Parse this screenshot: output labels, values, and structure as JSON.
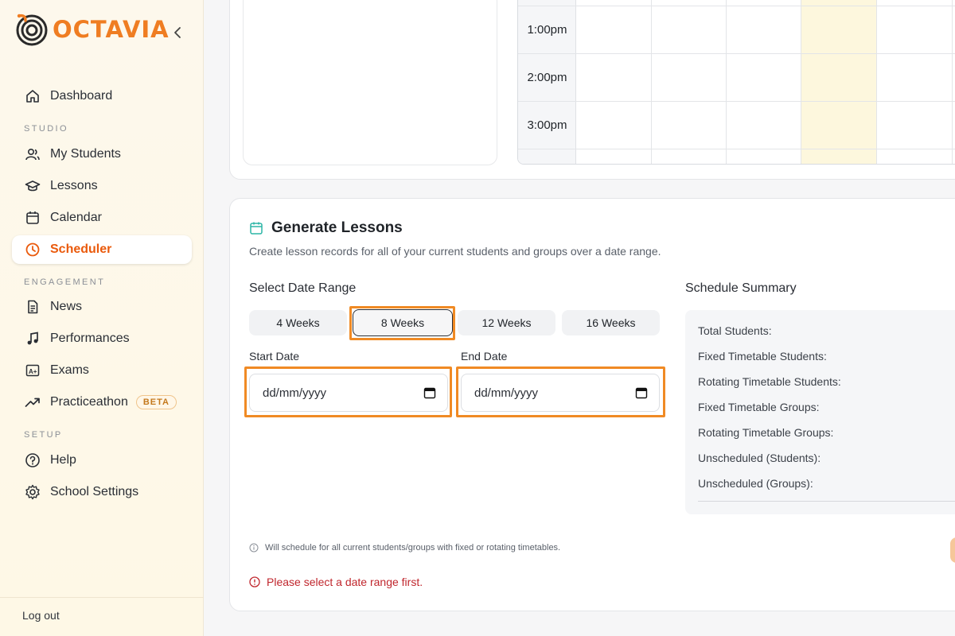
{
  "brand": {
    "name": "OCTAVIA",
    "color": "#ef7d22"
  },
  "sidebar": {
    "items": [
      {
        "label": "Dashboard",
        "icon": "home-icon"
      },
      {
        "label": "My Students",
        "icon": "users-icon"
      },
      {
        "label": "Lessons",
        "icon": "graduation-cap-icon"
      },
      {
        "label": "Calendar",
        "icon": "calendar-icon"
      },
      {
        "label": "Scheduler",
        "icon": "clock-icon",
        "active": true
      },
      {
        "label": "News",
        "icon": "document-icon"
      },
      {
        "label": "Performances",
        "icon": "music-note-icon"
      },
      {
        "label": "Exams",
        "icon": "grade-icon"
      },
      {
        "label": "Practiceathon",
        "icon": "trending-up-icon",
        "badge": "BETA"
      },
      {
        "label": "Help",
        "icon": "help-circle-icon"
      },
      {
        "label": "School Settings",
        "icon": "gear-icon"
      }
    ],
    "sections": {
      "studio": "STUDIO",
      "engagement": "ENGAGEMENT",
      "setup": "SETUP"
    },
    "logout": "Log out"
  },
  "timetable": {
    "times": [
      "1:00pm",
      "2:00pm",
      "3:00pm"
    ]
  },
  "generate": {
    "title": "Generate Lessons",
    "subtitle": "Create lesson records for all of your current students and groups over a date range.",
    "date_range_label": "Select Date Range",
    "weeks": [
      "4 Weeks",
      "8 Weeks",
      "12 Weeks",
      "16 Weeks"
    ],
    "selected_week": "8 Weeks",
    "start_label": "Start Date",
    "end_label": "End Date",
    "start_value": "dd/mm/yyyy",
    "end_value": "dd/mm/yyyy",
    "note": "Will schedule for all current students/groups with fixed or rotating timetables.",
    "error": "Please select a date range first."
  },
  "summary": {
    "title": "Schedule Summary",
    "rows": [
      "Total Students:",
      "Fixed Timetable Students:",
      "Rotating Timetable Students:",
      "Fixed Timetable Groups:",
      "Rotating Timetable Groups:",
      "Unscheduled (Students):",
      "Unscheduled (Groups):"
    ]
  },
  "colors": {
    "accent": "#ea5a0c",
    "highlight": "#f08a24",
    "error": "#c0262d",
    "teal": "#2bb5a6"
  }
}
